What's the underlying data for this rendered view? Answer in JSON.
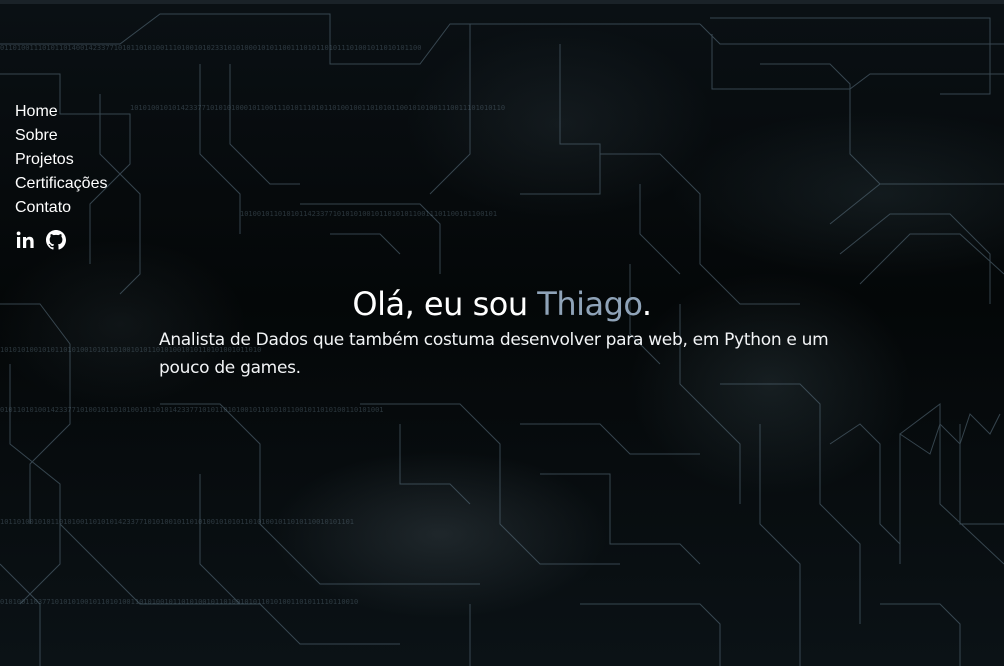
{
  "nav": {
    "items": [
      {
        "label": "Home"
      },
      {
        "label": "Sobre"
      },
      {
        "label": "Projetos"
      },
      {
        "label": "Certificações"
      },
      {
        "label": "Contato"
      }
    ]
  },
  "socials": [
    {
      "icon": "linkedin-icon"
    },
    {
      "icon": "github-icon"
    }
  ],
  "hero": {
    "greeting": "Olá, eu sou ",
    "name": "Thiago",
    "period": ".",
    "description": "Analista de Dados que também costuma desenvolver para web, em Python e um pouco de games."
  },
  "colors": {
    "background": "#05080a",
    "text": "#ffffff",
    "accent": "#8fa3b8",
    "circuit_lines": "#5d7483"
  }
}
